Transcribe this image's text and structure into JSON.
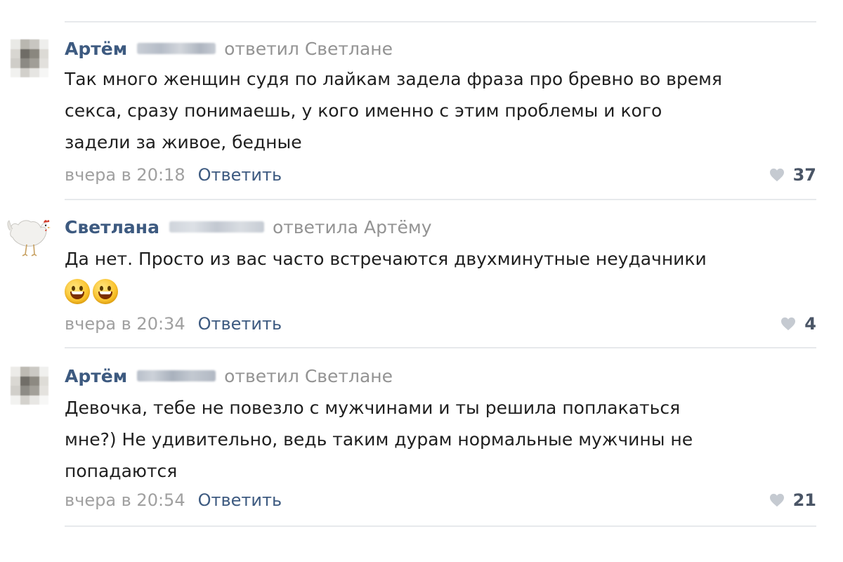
{
  "comments": [
    {
      "author": "Артём",
      "reply_to": "ответил Светлане",
      "text_lines": [
        "Так много женщин судя по лайкам задела фраза про бревно во время",
        "секса, сразу понимаешь, у кого именно с этим проблемы и кого",
        "задели за живое, бедные"
      ],
      "time": "вчера в 20:18",
      "reply_label": "Ответить",
      "likes": "37",
      "avatar_icon": "pixelated-avatar-icon"
    },
    {
      "author": "Светлана",
      "reply_to": "ответила Артёму",
      "text_lines": [
        "Да нет. Просто из вас часто встречаются двухминутные неудачники"
      ],
      "emojis": [
        "grinning-face-emoji",
        "grinning-face-emoji"
      ],
      "time": "вчера в 20:34",
      "reply_label": "Ответить",
      "likes": "4",
      "avatar_icon": "hen-avatar-icon"
    },
    {
      "author": "Артём",
      "reply_to": "ответил Светлане",
      "text_lines": [
        "Девочка, тебе не повезло с мужчинами и ты решила поплакаться",
        "мне?) Не удивительно, ведь таким дурам нормальные мужчины не",
        "попадаются"
      ],
      "time": "вчера в 20:54",
      "reply_label": "Ответить",
      "likes": "21",
      "avatar_icon": "pixelated-avatar-icon"
    }
  ],
  "colors": {
    "author_link": "#3d5a80",
    "secondary_text": "#939393",
    "divider": "#e7e9ec",
    "heart": "#c5cad1"
  }
}
